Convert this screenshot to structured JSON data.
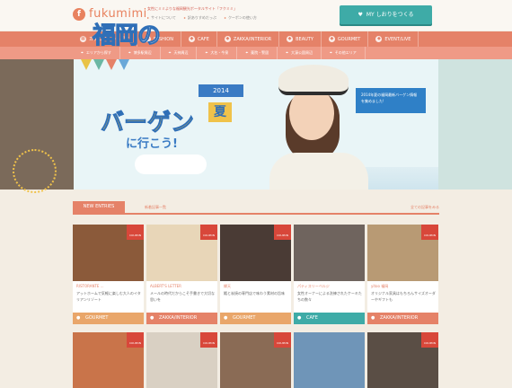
{
  "header": {
    "logo_mark": "f",
    "logo_text": "fukumimi",
    "tagline": "女性にミミよりな福岡観光ポータルサイト「フクミミ」",
    "links": [
      "サイトについて",
      "訳ありすめだっぷ",
      "クーポンの使い方"
    ],
    "my_button": "MY しおりをつくる"
  },
  "nav": {
    "items": [
      {
        "label": "カテゴリーから探す",
        "icon": "grid-icon"
      },
      {
        "label": "FASHION",
        "icon": "shirt-icon"
      },
      {
        "label": "CAFE",
        "icon": "cup-icon"
      },
      {
        "label": "ZAKKA/INTERIOR",
        "icon": "sofa-icon"
      },
      {
        "label": "BEAUTY",
        "icon": "lipstick-icon"
      },
      {
        "label": "GOURMET",
        "icon": "fork-icon"
      },
      {
        "label": "EVENT/LIVE",
        "icon": "flag-icon"
      }
    ]
  },
  "subnav": {
    "items": [
      "エリアから探す",
      "博多駅周辺",
      "天神周辺",
      "大名・今泉",
      "薬院・警固",
      "大濠公園周辺",
      "その他エリア"
    ]
  },
  "hero": {
    "title_line1": "福岡の",
    "year": "2014",
    "summer": "夏",
    "title_line2": "バーゲン",
    "title_line3": "に行こう!",
    "copy": "2014年夏の福岡最新バーゲン情報を集めました!"
  },
  "tabs": {
    "active": "NEW ENTRIES",
    "other": "新着記事一覧",
    "all": "全ての記事をみる"
  },
  "cards": [
    {
      "label": "RISTORANTE ...",
      "text": "アットホームで気軽に楽しむ大人のイタリアンリゾート",
      "category": "GOURMET",
      "color": "#e9a66a",
      "img": "#8b5a3a",
      "coupon": true
    },
    {
      "label": "ALBERT'S LETTER",
      "text": "メールの時代だからこそ手書きで大切な思いを",
      "category": "ZAKKA/INTERIOR",
      "color": "#e58268",
      "img": "#e8d6b8",
      "coupon": true
    },
    {
      "label": "縁天",
      "text": "鮨と炭焼の専門店で味わう素材の旨味",
      "category": "GOURMET",
      "color": "#e9a66a",
      "img": "#4a3b35",
      "coupon": true
    },
    {
      "label": "パティスリーベルジ",
      "text": "女性オーナーによる洗練されたケーキたちの数々",
      "category": "CAFE",
      "color": "#3eaba7",
      "img": "#6f645e",
      "coupon": false
    },
    {
      "label": "yitoo 福岡",
      "text": "オリジナル家具はもちろんサイズオーダーやギフトも",
      "category": "ZAKKA/INTERIOR",
      "color": "#e58268",
      "img": "#b89a74",
      "coupon": true
    }
  ],
  "cards_row2": [
    {
      "img": "#c9744a",
      "coupon": true
    },
    {
      "img": "#d9d0c3",
      "coupon": true
    },
    {
      "img": "#8a6b55",
      "coupon": true
    },
    {
      "img": "#6f95b8",
      "coupon": false
    },
    {
      "img": "#5a4e45",
      "coupon": true
    }
  ],
  "coupon_label": "COUPON"
}
